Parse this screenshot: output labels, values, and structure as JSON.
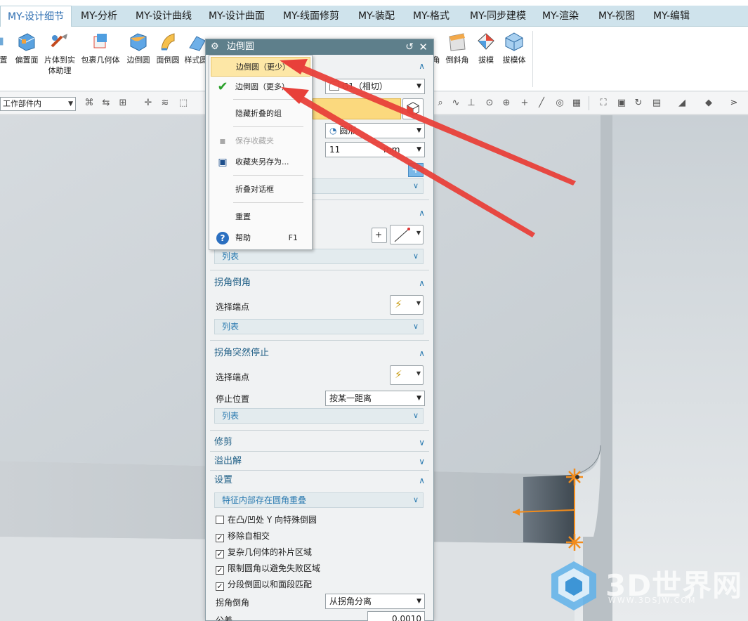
{
  "ribbon": {
    "tabs": [
      {
        "label": "MY-设计细节",
        "active": true
      },
      {
        "label": "MY-分析"
      },
      {
        "label": "MY-设计曲线"
      },
      {
        "label": "MY-设计曲面"
      },
      {
        "label": "MY-线面修剪"
      },
      {
        "label": "MY-装配"
      },
      {
        "label": "MY-格式"
      },
      {
        "label": "MY-同步建模"
      },
      {
        "label": "MY-渲染"
      },
      {
        "label": "MY-视图"
      },
      {
        "label": "MY-编辑"
      }
    ],
    "buttons": [
      {
        "label": "置",
        "icon": "placement-icon"
      },
      {
        "label": "偏置面",
        "icon": "offset-face-icon"
      },
      {
        "label": "片体到实体助理",
        "icon": "sheet-to-solid-icon"
      },
      {
        "label": "包裹几何体",
        "icon": "wrap-geometry-icon"
      },
      {
        "label": "边倒圆",
        "icon": "edge-blend-icon"
      },
      {
        "label": "面倒圆",
        "icon": "face-blend-icon"
      },
      {
        "label": "样式圆",
        "icon": "style-blend-icon"
      },
      {
        "label": "倒斜角",
        "icon": "chamfer-icon"
      },
      {
        "label": "拔模",
        "icon": "draft-icon"
      },
      {
        "label": "拔模体",
        "icon": "draft-body-icon"
      }
    ],
    "hidden_fragment": "角"
  },
  "toolbar2": {
    "scope_combo": "工作部件内"
  },
  "dialog": {
    "title": "边倒圆",
    "continuity_combo": "G1（相切）",
    "shape_combo": "圆形",
    "radius_value": "11",
    "radius_unit": "mm",
    "list_label": "列表",
    "sections": {
      "corner_chamfer": {
        "title": "拐角倒角",
        "select_endpoint": "选择端点",
        "list": "列表"
      },
      "corner_abrupt_stop": {
        "title": "拐角突然停止",
        "select_endpoint": "选择端点",
        "stop_position": "停止位置",
        "stop_position_value": "按某一距离",
        "list": "列表"
      },
      "trim": {
        "title": "修剪"
      },
      "overflow": {
        "title": "溢出解"
      },
      "settings": {
        "title": "设置",
        "overlap_combo": "特征内部存在圆角重叠",
        "checkboxes": [
          {
            "label": "在凸/凹处 Y 向特殊倒圆",
            "checked": false
          },
          {
            "label": "移除自相交",
            "checked": true
          },
          {
            "label": "复杂几何体的补片区域",
            "checked": true
          },
          {
            "label": "限制圆角以避免失败区域",
            "checked": true
          },
          {
            "label": "分段倒圆以和面段匹配",
            "checked": true
          }
        ],
        "corner_chamfer_label": "拐角倒角",
        "corner_chamfer_value": "从拐角分离",
        "tolerance_label": "公差",
        "tolerance_value": "0.0010"
      }
    }
  },
  "menu": {
    "items": [
      {
        "label": "边倒圆（更少）",
        "highlighted": true
      },
      {
        "label": "边倒圆（更多）",
        "icon": "checkmark-icon"
      },
      {
        "label": "隐藏折叠的组"
      },
      {
        "label": "保存收藏夹",
        "disabled": true,
        "icon": "save-icon"
      },
      {
        "label": "收藏夹另存为...",
        "icon": "save-as-icon"
      },
      {
        "label": "折叠对话框"
      },
      {
        "label": "重置"
      },
      {
        "label": "帮助",
        "shortcut": "F1",
        "icon": "help-icon"
      }
    ]
  },
  "watermark": {
    "text": "3D世界网",
    "url": "WWW.3DSJW.COM"
  },
  "colors": {
    "ribbon_tab_bg": "#cfe3ec",
    "dialog_title_bg": "#5e7f8b",
    "highlight": "#fde7a6",
    "annotation_arrow": "#e8403a",
    "accent_orange": "#f28c1c"
  }
}
